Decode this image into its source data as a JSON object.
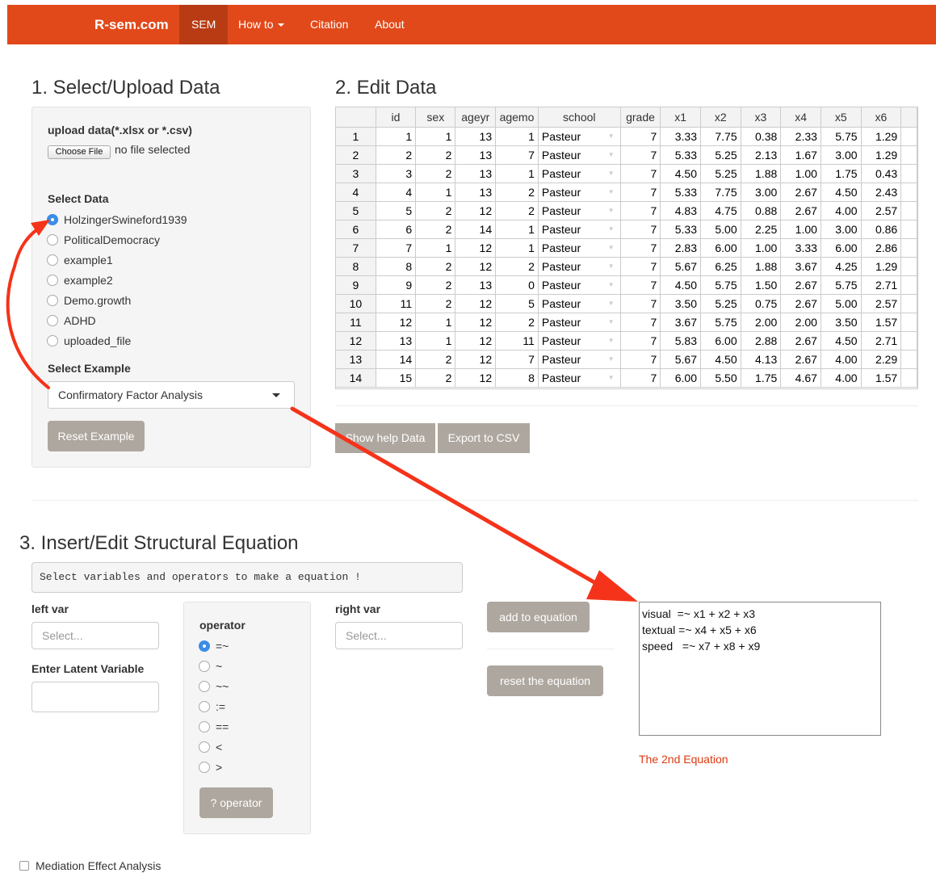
{
  "nav": {
    "brand": "R-sem.com",
    "items": [
      "SEM",
      "How to",
      "Citation",
      "About"
    ]
  },
  "section1": {
    "title": "1. Select/Upload Data",
    "upload_label": "upload data(*.xlsx or *.csv)",
    "choose_file": "Choose File",
    "no_file": "no file selected",
    "select_data_label": "Select Data",
    "datasets": [
      "HolzingerSwineford1939",
      "PoliticalDemocracy",
      "example1",
      "example2",
      "Demo.growth",
      "ADHD",
      "uploaded_file"
    ],
    "selected_dataset": "HolzingerSwineford1939",
    "select_example_label": "Select Example",
    "example_value": "Confirmatory Factor Analysis",
    "reset_example": "Reset Example"
  },
  "section2": {
    "title": "2. Edit Data",
    "columns": [
      "",
      "id",
      "sex",
      "ageyr",
      "agemo",
      "school",
      "grade",
      "x1",
      "x2",
      "x3",
      "x4",
      "x5",
      "x6"
    ],
    "rows": [
      [
        "1",
        "1",
        "1",
        "13",
        "1",
        "Pasteur",
        "7",
        "3.33",
        "7.75",
        "0.38",
        "2.33",
        "5.75",
        "1.29"
      ],
      [
        "2",
        "2",
        "2",
        "13",
        "7",
        "Pasteur",
        "7",
        "5.33",
        "5.25",
        "2.13",
        "1.67",
        "3.00",
        "1.29"
      ],
      [
        "3",
        "3",
        "2",
        "13",
        "1",
        "Pasteur",
        "7",
        "4.50",
        "5.25",
        "1.88",
        "1.00",
        "1.75",
        "0.43"
      ],
      [
        "4",
        "4",
        "1",
        "13",
        "2",
        "Pasteur",
        "7",
        "5.33",
        "7.75",
        "3.00",
        "2.67",
        "4.50",
        "2.43"
      ],
      [
        "5",
        "5",
        "2",
        "12",
        "2",
        "Pasteur",
        "7",
        "4.83",
        "4.75",
        "0.88",
        "2.67",
        "4.00",
        "2.57"
      ],
      [
        "6",
        "6",
        "2",
        "14",
        "1",
        "Pasteur",
        "7",
        "5.33",
        "5.00",
        "2.25",
        "1.00",
        "3.00",
        "0.86"
      ],
      [
        "7",
        "7",
        "1",
        "12",
        "1",
        "Pasteur",
        "7",
        "2.83",
        "6.00",
        "1.00",
        "3.33",
        "6.00",
        "2.86"
      ],
      [
        "8",
        "8",
        "2",
        "12",
        "2",
        "Pasteur",
        "7",
        "5.67",
        "6.25",
        "1.88",
        "3.67",
        "4.25",
        "1.29"
      ],
      [
        "9",
        "9",
        "2",
        "13",
        "0",
        "Pasteur",
        "7",
        "4.50",
        "5.75",
        "1.50",
        "2.67",
        "5.75",
        "2.71"
      ],
      [
        "10",
        "11",
        "2",
        "12",
        "5",
        "Pasteur",
        "7",
        "3.50",
        "5.25",
        "0.75",
        "2.67",
        "5.00",
        "2.57"
      ],
      [
        "11",
        "12",
        "1",
        "12",
        "2",
        "Pasteur",
        "7",
        "3.67",
        "5.75",
        "2.00",
        "2.00",
        "3.50",
        "1.57"
      ],
      [
        "12",
        "13",
        "1",
        "12",
        "11",
        "Pasteur",
        "7",
        "5.83",
        "6.00",
        "2.88",
        "2.67",
        "4.50",
        "2.71"
      ],
      [
        "13",
        "14",
        "2",
        "12",
        "7",
        "Pasteur",
        "7",
        "5.67",
        "4.50",
        "4.13",
        "2.67",
        "4.00",
        "2.29"
      ],
      [
        "14",
        "15",
        "2",
        "12",
        "8",
        "Pasteur",
        "7",
        "6.00",
        "5.50",
        "1.75",
        "4.67",
        "4.00",
        "1.57"
      ]
    ],
    "show_help": "Show help Data",
    "export_csv": "Export to CSV"
  },
  "section3": {
    "title": "3. Insert/Edit Structural Equation",
    "hint": "Select variables and operators to make a equation !",
    "left_var_label": "left var",
    "left_var_placeholder": "Select...",
    "latent_label": "Enter Latent Variable",
    "operator_label": "operator",
    "operators": [
      "=~",
      "~",
      "~~",
      ":=",
      "==",
      "<",
      ">"
    ],
    "selected_operator": "=~",
    "operator_help": "? operator",
    "right_var_label": "right var",
    "right_var_placeholder": "Select...",
    "add_to_equation": "add to equation",
    "reset_equation": "reset the equation",
    "equation_text": "visual  =~ x1 + x2 + x3\ntextual =~ x4 + x5 + x6\nspeed   =~ x7 + x8 + x9",
    "annotation": "The 2nd Equation",
    "mediation_label": "Mediation Effect Analysis"
  },
  "colors": {
    "navbar": "#e1491a",
    "navbar_active": "#b83b14",
    "button": "#aea79f",
    "arrow": "#f5331a",
    "annotation": "#dd3a10"
  }
}
